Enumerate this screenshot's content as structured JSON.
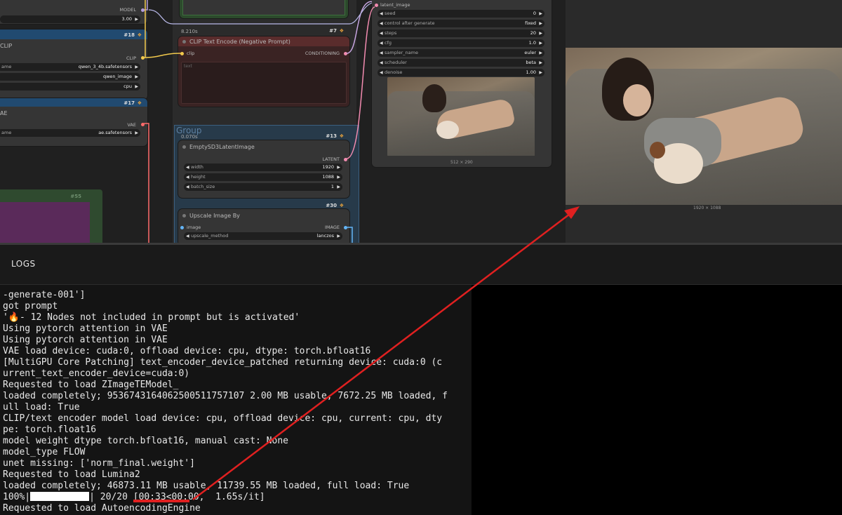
{
  "nodes": {
    "model_partial": {
      "model_label": "MODEL",
      "shift_value": "3.00"
    },
    "clip_loader": {
      "id": "#18",
      "title": "CLIP",
      "output": "CLIP",
      "clip_name_label": "ame",
      "clip_name": "qwen_3_4b.safetensors",
      "type": "qwen_image",
      "device": "cpu"
    },
    "vae_loader": {
      "id": "#17",
      "title": "AE",
      "output": "VAE",
      "vae_name_label": "ame",
      "vae_name": "ae.safetensors"
    },
    "neg_prompt": {
      "id": "#7",
      "time": "8.210s",
      "title": "CLIP Text Encode (Negative Prompt)",
      "input": "clip",
      "output": "CONDITIONING",
      "placeholder": "text"
    },
    "group": {
      "label": "Group"
    },
    "latent": {
      "id": "#13",
      "time": "0.070s",
      "title": "EmptySD3LatentImage",
      "output": "LATENT",
      "width_label": "width",
      "width": "1920",
      "height_label": "height",
      "height": "1088",
      "batch_label": "batch_size",
      "batch": "1"
    },
    "upscale": {
      "id": "#30",
      "title": "Upscale Image By",
      "input": "image",
      "output": "IMAGE",
      "method_label": "upscale_method",
      "method": "lanczos"
    },
    "purple_node": {
      "id": "#55"
    },
    "ksampler": {
      "input": "latent_image",
      "widgets": [
        {
          "label": "seed",
          "value": "0"
        },
        {
          "label": "control after generate",
          "value": "fixed"
        },
        {
          "label": "steps",
          "value": "20"
        },
        {
          "label": "cfg",
          "value": "1.0"
        },
        {
          "label": "sampler_name",
          "value": "euler"
        },
        {
          "label": "scheduler",
          "value": "beta"
        },
        {
          "label": "denoise",
          "value": "1.00"
        }
      ],
      "preview_size": "512 × 290"
    }
  },
  "preview": {
    "size": "1920 × 1088"
  },
  "logs": {
    "title": "LOGS",
    "lines": [
      "-generate-001']",
      "got prompt",
      "'🔥- 12 Nodes not included in prompt but is activated'",
      "Using pytorch attention in VAE",
      "Using pytorch attention in VAE",
      "VAE load device: cuda:0, offload device: cpu, dtype: torch.bfloat16",
      "[MultiGPU Core Patching] text_encoder_device_patched returning device: cuda:0 (c",
      "urrent_text_encoder_device=cuda:0)",
      "Requested to load ZImageTEModel_",
      "loaded completely; 9536743164062500511757107 2.00 MB usable, 7672.25 MB loaded, f",
      "ull load: True",
      "CLIP/text encoder model load device: cpu, offload device: cpu, current: cpu, dty",
      "pe: torch.float16",
      "model weight dtype torch.bfloat16, manual cast: None",
      "model_type FLOW",
      "unet missing: ['norm_final.weight']",
      "Requested to load Lumina2",
      "loaded completely; 46873.11 MB usable, 11739.55 MB loaded, full load: True"
    ],
    "progress_prefix": "100%|",
    "progress_suffix": "| 20/20 [00:33<00:00,  1.65s/it]",
    "last_line": "Requested to load AutoencodingEngine"
  }
}
